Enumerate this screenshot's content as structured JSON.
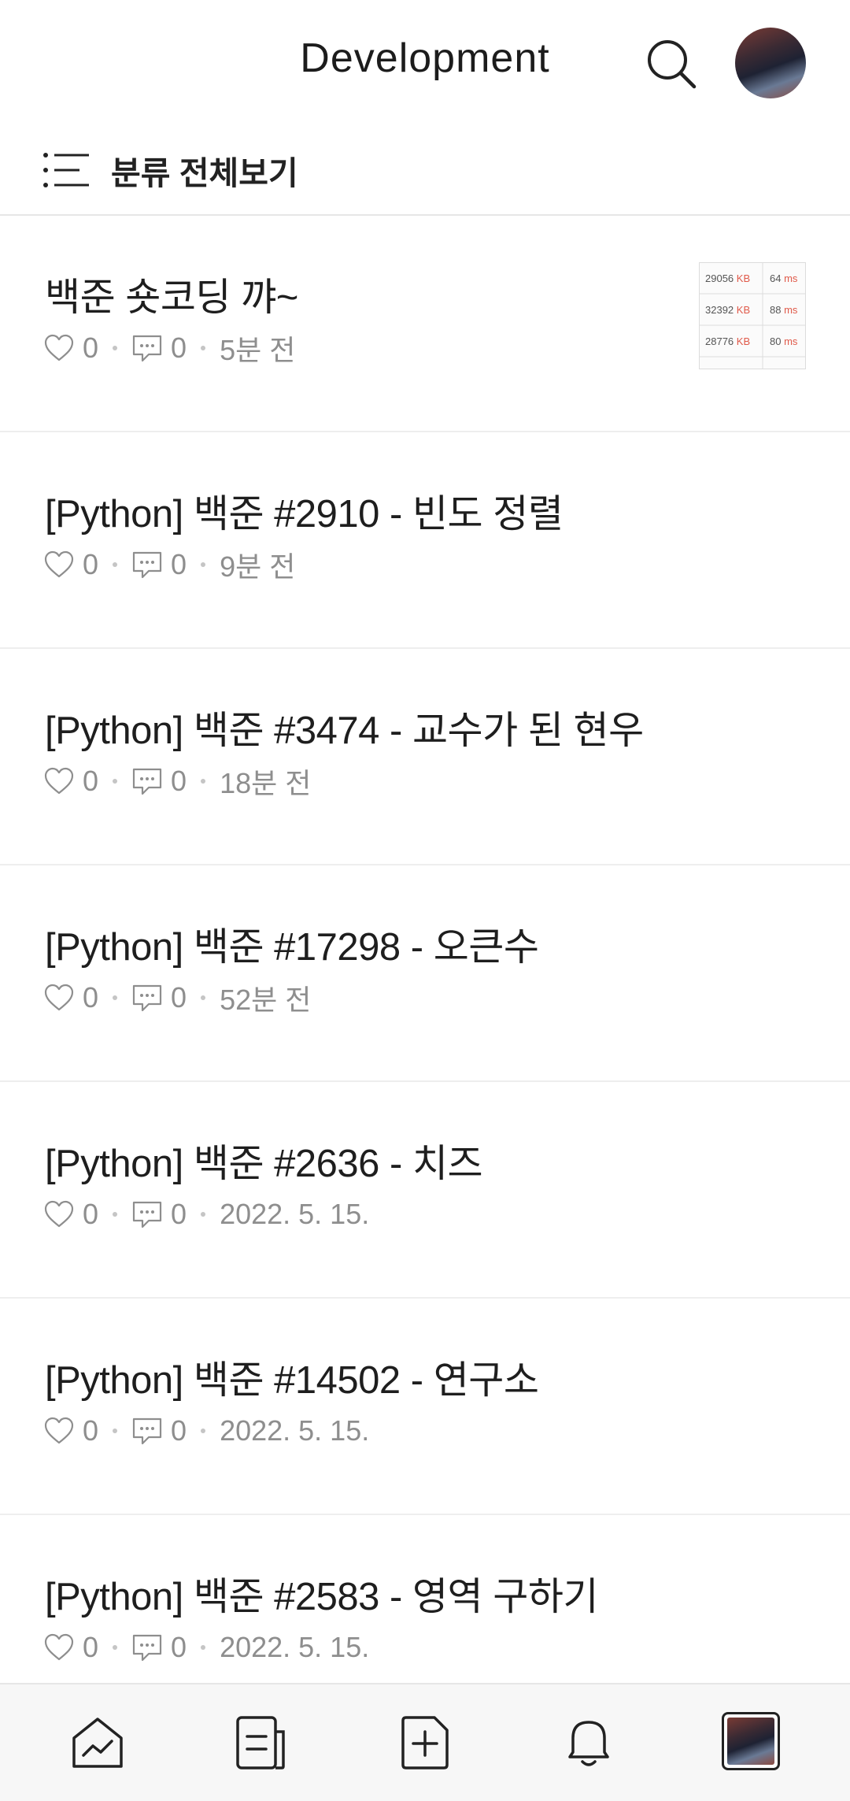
{
  "header": {
    "title": "Development",
    "search_icon": "search-icon",
    "avatar": "profile-avatar"
  },
  "category": {
    "label": "분류 전체보기",
    "icon": "list-icon"
  },
  "posts": [
    {
      "title": "백준 숏코딩 꺄~",
      "likes": "0",
      "comments": "0",
      "time": "5분 전"
    },
    {
      "title": "[Python] 백준 #2910 - 빈도 정렬",
      "likes": "0",
      "comments": "0",
      "time": "9분 전",
      "thumbnail": {
        "rows": [
          {
            "kb": "29056",
            "kb_unit": "KB",
            "ms": "64",
            "ms_unit": "ms"
          },
          {
            "kb": "32392",
            "kb_unit": "KB",
            "ms": "88",
            "ms_unit": "ms"
          },
          {
            "kb": "28776",
            "kb_unit": "KB",
            "ms": "80",
            "ms_unit": "ms"
          }
        ]
      }
    },
    {
      "title": "[Python] 백준 #3474 - 교수가 된 현우",
      "likes": "0",
      "comments": "0",
      "time": "18분 전"
    },
    {
      "title": "[Python] 백준 #17298 - 오큰수",
      "likes": "0",
      "comments": "0",
      "time": "52분 전"
    },
    {
      "title": "[Python] 백준 #2636 - 치즈",
      "likes": "0",
      "comments": "0",
      "time": "2022. 5. 15."
    },
    {
      "title": "[Python] 백준 #14502 - 연구소",
      "likes": "0",
      "comments": "0",
      "time": "2022. 5. 15."
    },
    {
      "title": "[Python] 백준 #2583 - 영역 구하기",
      "likes": "0",
      "comments": "0",
      "time": "2022. 5. 15."
    }
  ],
  "tabbar": {
    "tabs": [
      "stats-icon",
      "posts-icon",
      "new-post-icon",
      "notification-icon",
      "profile-tab"
    ]
  },
  "colors": {
    "text": "#1e1e1e",
    "meta": "#8e8e8e",
    "thumb_red": "#e05a4a"
  }
}
